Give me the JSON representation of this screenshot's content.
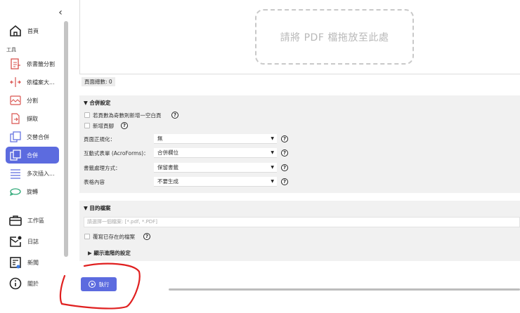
{
  "sidebar": {
    "collapse_glyph": "‹",
    "section_label": "工具",
    "items": [
      {
        "id": "home",
        "label": "首頁",
        "icon": "home-icon"
      },
      {
        "id": "split-bookmark",
        "label": "依書籤分割",
        "icon": "split-bookmark-icon"
      },
      {
        "id": "split-size",
        "label": "依檔案大...",
        "icon": "split-size-icon"
      },
      {
        "id": "split",
        "label": "分割",
        "icon": "split-icon"
      },
      {
        "id": "extract",
        "label": "擷取",
        "icon": "extract-icon"
      },
      {
        "id": "alternate-merge",
        "label": "交替合併",
        "icon": "alternate-merge-icon"
      },
      {
        "id": "merge",
        "label": "合併",
        "icon": "merge-icon",
        "active": true
      },
      {
        "id": "multi-insert",
        "label": "多次插入...",
        "icon": "multi-insert-icon"
      },
      {
        "id": "rotate",
        "label": "旋轉",
        "icon": "rotate-icon"
      }
    ],
    "bottom_items": [
      {
        "id": "workspace",
        "label": "工作區",
        "icon": "briefcase-icon"
      },
      {
        "id": "log",
        "label": "日誌",
        "icon": "mail-icon"
      },
      {
        "id": "news",
        "label": "新聞",
        "icon": "news-icon"
      },
      {
        "id": "about",
        "label": "關於",
        "icon": "info-icon"
      }
    ]
  },
  "drop_zone": {
    "text": "請將 PDF 檔拖放至此處"
  },
  "page_count": {
    "label": "頁面總數: 0"
  },
  "merge_settings": {
    "title": "▼ 合併設定",
    "odd_pages_label": "若頁數為奇數則新增一空白頁",
    "footer_label": "新增頁腳",
    "rows": [
      {
        "label": "頁面正規化：",
        "value": "無"
      },
      {
        "label": "互動式表單 (AcroForms)：",
        "value": "合併欄位"
      },
      {
        "label": "書籤處理方式：",
        "value": "保留書籤"
      },
      {
        "label": "表格內容",
        "value": "不要生成"
      }
    ]
  },
  "destination": {
    "title": "▼ 目的檔案",
    "path_placeholder": "請選擇一個檔案: [*.pdf, *.PDF]",
    "overwrite_label": "覆寫已存在的檔案",
    "advanced_label": "▶ 顯示進階的設定"
  },
  "run_button": {
    "label": "執行"
  },
  "help_glyph": "?",
  "select_arrow": "▼",
  "colors": {
    "accent": "#5c6bdf",
    "panel": "#f1f1f1",
    "annotation": "#e02020"
  }
}
